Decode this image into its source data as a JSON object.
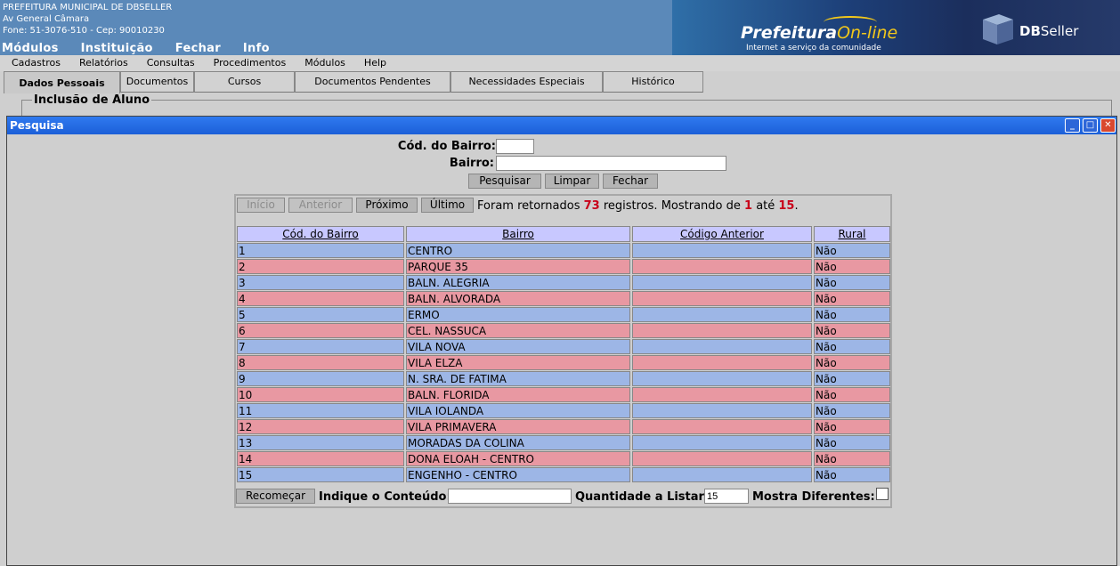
{
  "header": {
    "org_lines": [
      "PREFEITURA MUNICIPAL DE DBSELLER",
      "Av General Câmara",
      "Fone: 51-3076-510  -  Cep: 90010230"
    ],
    "nav": [
      "Módulos",
      "Instituição",
      "Fechar",
      "Info"
    ],
    "brand_main": "Prefeitura",
    "brand_online": "On-line",
    "brand_tagline": "Internet a serviço da comunidade",
    "dbseller_bold": "DB",
    "dbseller_rest": "Seller"
  },
  "menubar": [
    "Cadastros",
    "Relatórios",
    "Consultas",
    "Procedimentos",
    "Módulos",
    "Help"
  ],
  "tabs": [
    "Dados Pessoais",
    "Documentos",
    "Cursos",
    "Documentos Pendentes",
    "Necessidades Especiais",
    "Histórico"
  ],
  "fieldset_legend": "Inclusão de Aluno",
  "window": {
    "title": "Pesquisa",
    "min_glyph": "_",
    "max_glyph": "□",
    "close_glyph": "✕"
  },
  "search": {
    "cod_label": "Cód. do Bairro:",
    "cod_value": "",
    "bairro_label": "Bairro:",
    "bairro_value": "",
    "pesquisar": "Pesquisar",
    "limpar": "Limpar",
    "fechar": "Fechar"
  },
  "pager": {
    "inicio": "Início",
    "anterior": "Anterior",
    "proximo": "Próximo",
    "ultimo": "Último",
    "text1": "Foram retornados ",
    "total": "73",
    "text2": " registros. Mostrando de ",
    "from": "1",
    "text3": " até ",
    "to": "15",
    "text4": "."
  },
  "grid": {
    "headers": [
      "Cód. do Bairro",
      "Bairro",
      "Código Anterior",
      "Rural"
    ],
    "rows": [
      [
        "1",
        "CENTRO",
        "",
        "Não"
      ],
      [
        "2",
        "PARQUE 35",
        "",
        "Não"
      ],
      [
        "3",
        "BALN. ALEGRIA",
        "",
        "Não"
      ],
      [
        "4",
        "BALN. ALVORADA",
        "",
        "Não"
      ],
      [
        "5",
        "ERMO",
        "",
        "Não"
      ],
      [
        "6",
        "CEL. NASSUCA",
        "",
        "Não"
      ],
      [
        "7",
        "VILA NOVA",
        "",
        "Não"
      ],
      [
        "8",
        "VILA ELZA",
        "",
        "Não"
      ],
      [
        "9",
        "N. SRA. DE FATIMA",
        "",
        "Não"
      ],
      [
        "10",
        "BALN. FLORIDA",
        "",
        "Não"
      ],
      [
        "11",
        "VILA IOLANDA",
        "",
        "Não"
      ],
      [
        "12",
        "VILA PRIMAVERA",
        "",
        "Não"
      ],
      [
        "13",
        "MORADAS DA COLINA",
        "",
        "Não"
      ],
      [
        "14",
        "DONA ELOAH - CENTRO",
        "",
        "Não"
      ],
      [
        "15",
        "ENGENHO - CENTRO",
        "",
        "Não"
      ]
    ]
  },
  "footer": {
    "recomecar": "Recomeçar",
    "indique_label": "Indique o Conteúdo:",
    "indique_value": "",
    "quantidade_label": "Quantidade a Listar:",
    "quantidade_value": "15",
    "mostra_label": "Mostra Diferentes:"
  },
  "colors": {
    "row_odd": "#9db6e6",
    "row_even": "#e898a2",
    "header_bg": "#c8c8ff",
    "title_bar": "#1c5fd8",
    "highlight_red": "#c8001a"
  }
}
